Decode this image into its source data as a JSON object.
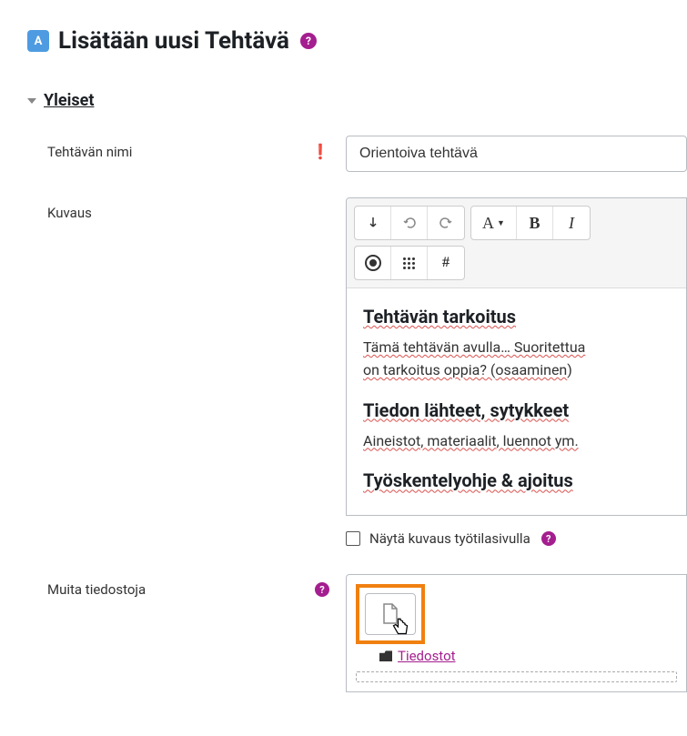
{
  "header": {
    "icon": "A",
    "title": "Lisätään uusi Tehtävä"
  },
  "section_general": {
    "title": "Yleiset"
  },
  "fields": {
    "name": {
      "label": "Tehtävän nimi",
      "value": "Orientoiva tehtävä"
    },
    "description": {
      "label": "Kuvaus"
    },
    "files": {
      "label": "Muita tiedostoja"
    }
  },
  "editor": {
    "h1": "Tehtävän tarkoitus",
    "p1a": "Tämä tehtävän avulla… Suoritettua",
    "p1b": "on tarkoitus oppia? (",
    "p1c": "osaaminen",
    "p1d": ")",
    "h2": "Tiedon lähteet, sytykkeet",
    "p2": "Aineistot, materiaalit, luennot ym.",
    "h3": "Työskentelyohje & ajoitus"
  },
  "checkbox": {
    "show_description": "Näytä kuvaus työtilasivulla"
  },
  "filepicker": {
    "tab_label": "Tiedostot"
  },
  "toolbar": {
    "font_a": "A",
    "bold": "B",
    "italic": "I",
    "hash": "#"
  }
}
